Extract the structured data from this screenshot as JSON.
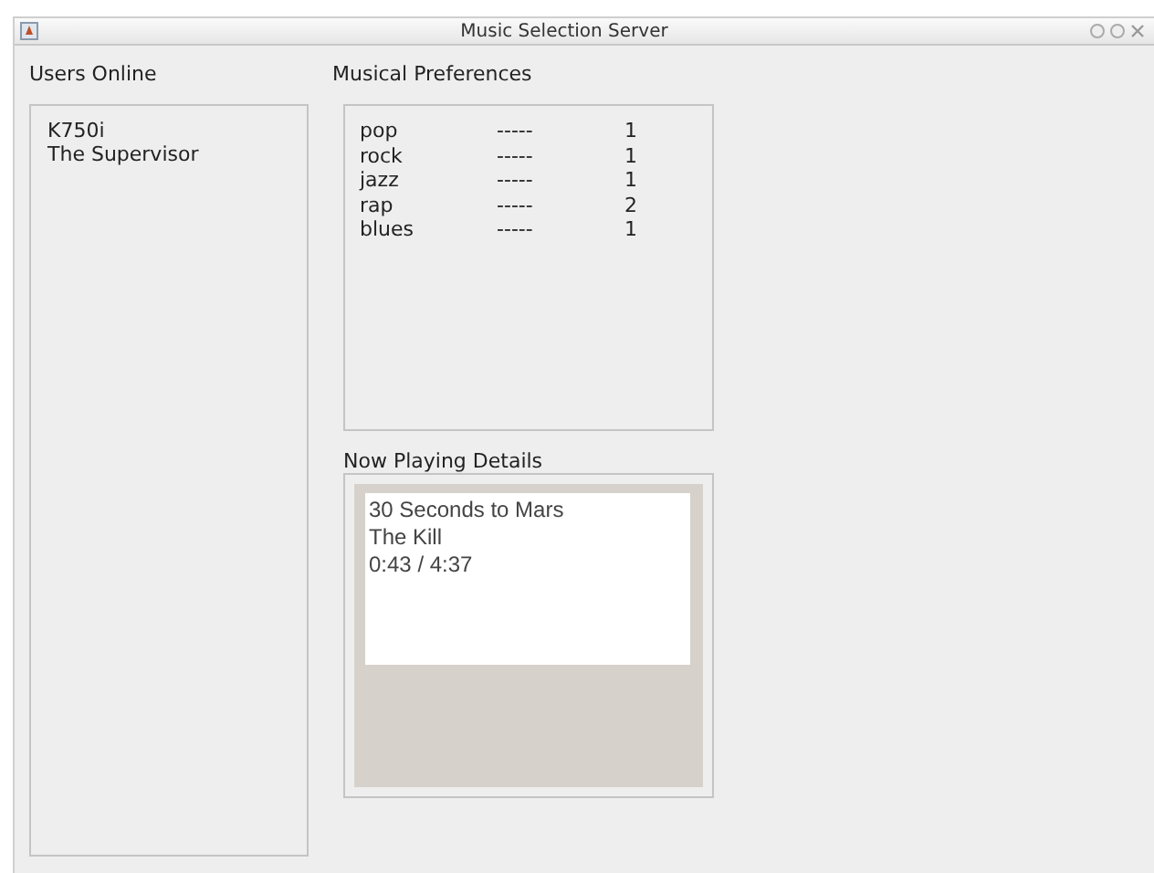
{
  "window": {
    "title": "Music Selection Server"
  },
  "users_online": {
    "label": "Users Online",
    "items": [
      "K750i",
      "The Supervisor"
    ]
  },
  "musical_preferences": {
    "label": "Musical Preferences",
    "rows": [
      {
        "genre": "pop",
        "separator": "-----",
        "count": "1"
      },
      {
        "genre": "rock",
        "separator": "-----",
        "count": "1"
      },
      {
        "genre": "jazz",
        "separator": "-----",
        "count": "1"
      },
      {
        "genre": "rap",
        "separator": "-----",
        "count": "2"
      },
      {
        "genre": "blues",
        "separator": "-----",
        "count": "1"
      }
    ]
  },
  "now_playing": {
    "label": "Now Playing Details",
    "lines": [
      "30 Seconds to Mars",
      "The Kill",
      "0:43 / 4:37"
    ]
  }
}
